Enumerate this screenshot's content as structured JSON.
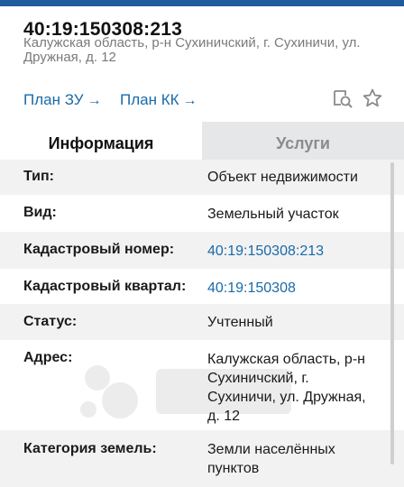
{
  "header": {
    "cadastral_number": "40:19:150308:213",
    "address_line1": "Калужская область, р-н Сухиничский, г. Сухиничи, ул.",
    "address_line2": "Дружная, д. 12",
    "links": [
      {
        "label": "План ЗУ",
        "arrow": "→"
      },
      {
        "label": "План КК",
        "arrow": "→"
      }
    ],
    "icons": [
      "map-search-icon",
      "star-icon"
    ]
  },
  "tabs": [
    {
      "label": "Информация",
      "active": true
    },
    {
      "label": "Услуги",
      "active": false
    }
  ],
  "info": {
    "rows": [
      {
        "label": "Тип:",
        "value": "Объект недвижимости"
      },
      {
        "label": "Вид:",
        "value": "Земельный участок"
      },
      {
        "label": "Кадастровый номер:",
        "value": "40:19:150308:213"
      },
      {
        "label": "Кадастровый квартал:",
        "value": "40:19:150308"
      },
      {
        "label": "Статус:",
        "value": "Учтенный"
      },
      {
        "label": "Адрес:",
        "value_lines": [
          "Калужская область, р-н",
          "Сухиничский, г.",
          "Сухиничи, ул. Дружная,",
          "д. 12"
        ]
      },
      {
        "label": "Категория земель:",
        "value_lines": [
          "Земли населённых",
          "пунктов"
        ]
      }
    ]
  },
  "colors": {
    "accent": "#1f5b9c",
    "link": "#1a6aa8",
    "tab_inactive_bg": "#e6e7e9",
    "row_shade": "#f2f2f2"
  }
}
